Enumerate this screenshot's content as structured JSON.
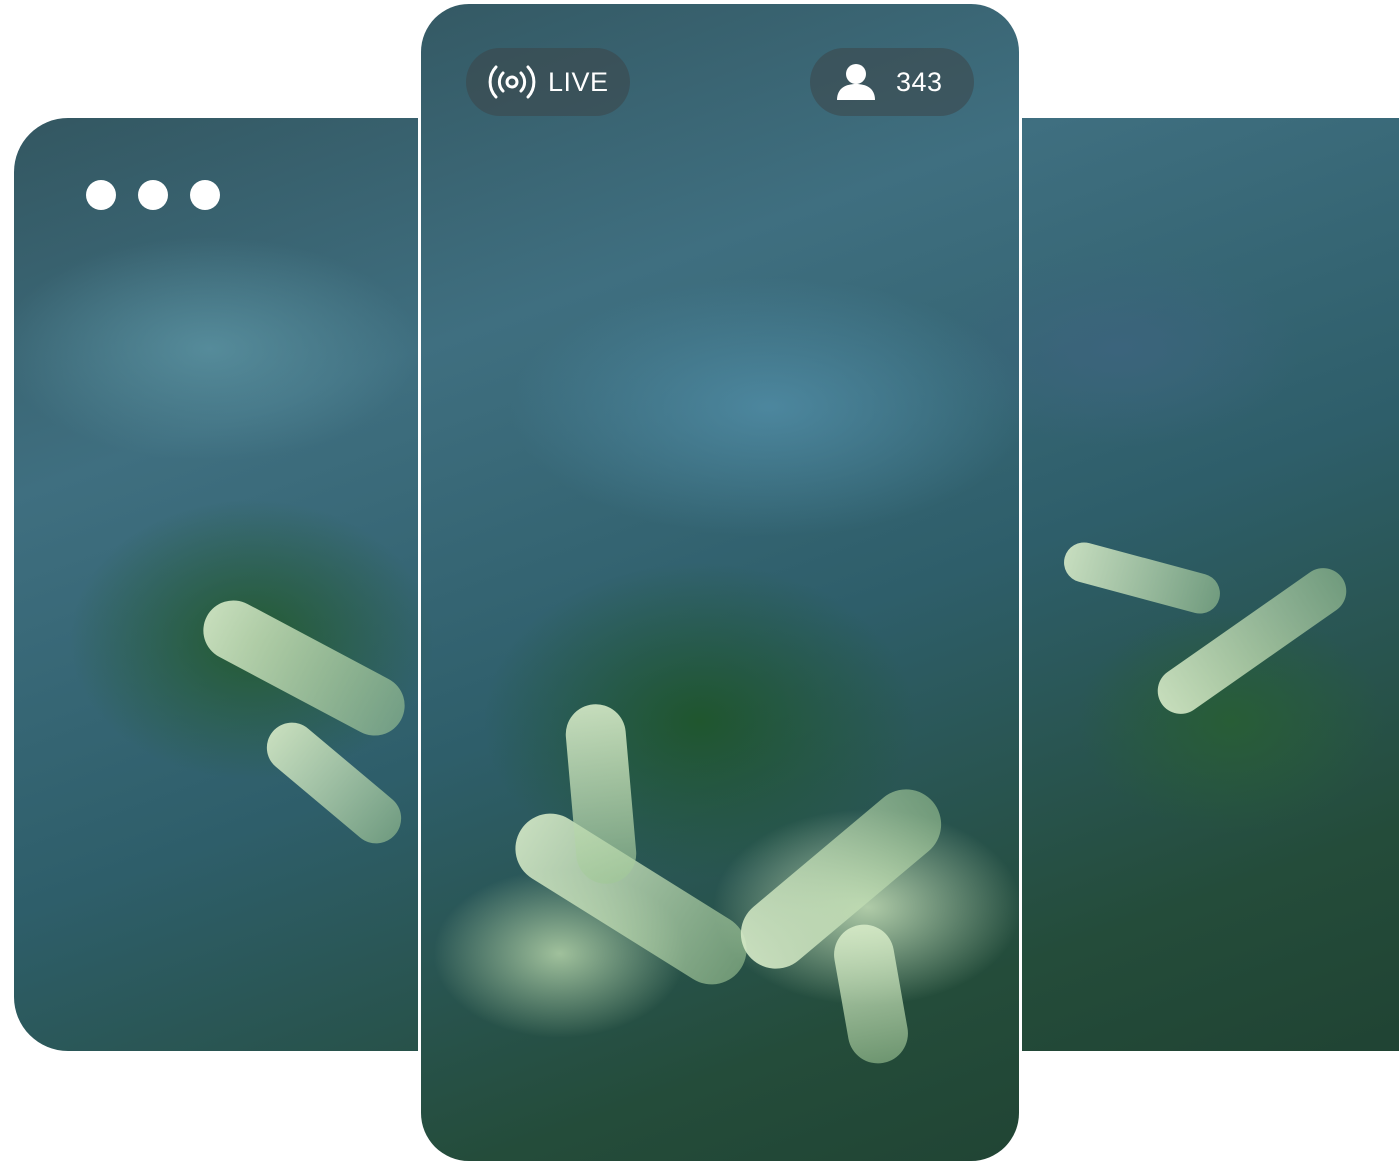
{
  "stream": {
    "status_label": "LIVE",
    "viewer_count": "343"
  },
  "icons": {
    "live": "broadcast-icon",
    "viewers": "user-icon",
    "more": "more-horizontal-icon"
  },
  "colors": {
    "overlay_pill": "#3c4648",
    "text": "#ffffff"
  }
}
